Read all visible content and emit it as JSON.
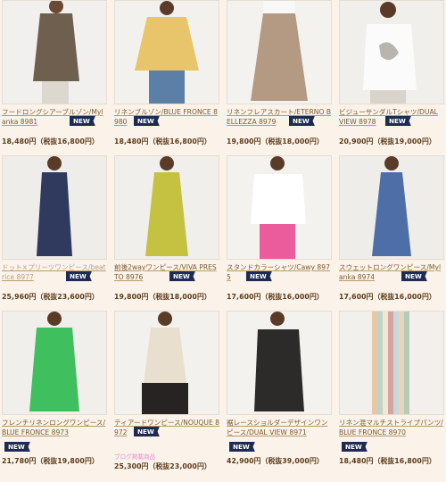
{
  "badge_label": "NEW",
  "products": [
    {
      "name": "フードロングシアーブルゾン/Mylanka 8981",
      "price": "18,480円（税抜16,800円）",
      "badge": "NEW"
    },
    {
      "name": "リネンブルゾン/BLUE FRONCE 8980",
      "price": "18,480円（税抜16,800円）",
      "badge": "NEW"
    },
    {
      "name": "リネンフレアスカート/ETERNO BELLEZZA 8979",
      "price": "19,800円（税抜18,000円）",
      "badge": "NEW"
    },
    {
      "name": "ビジューサンダルTシャツ/DUAL VIEW 8978",
      "price": "20,900円（税抜19,000円）",
      "badge": "NEW"
    },
    {
      "name": "ドット×プリーツワンピース/beatrice 8977",
      "price": "25,960円（税抜23,600円）",
      "badge": "NEW"
    },
    {
      "name": "前後2wayワンピース/VIVA PRESTO 8976",
      "price": "19,800円（税抜18,000円）",
      "badge": "NEW"
    },
    {
      "name": "スタンドカラーシャツ/Cawy 8975",
      "price": "17,600円（税抜16,000円）",
      "badge": "NEW"
    },
    {
      "name": "スウェットロングワンピース/Mylanka 8974",
      "price": "17,600円（税抜16,000円）",
      "badge": "NEW"
    },
    {
      "name": "フレンチリネンロングワンピース/BLUE FRONCE 8973",
      "price": "21,780円（税抜19,800円）",
      "badge": "NEW"
    },
    {
      "name": "ティアードワンピース/NOUQUE 8972",
      "price": "25,300円（税抜23,000円）",
      "badge": "NEW",
      "note": "ブログ掲載商品"
    },
    {
      "name": "裾レースショルダーデザインワンピース/DUAL VIEW 8971",
      "price": "42,900円（税抜39,000円）",
      "badge": "NEW"
    },
    {
      "name": "リネン混マルチストライプパンツ/BLUE FRONCE 8970",
      "price": "18,480円（税抜16,800円）",
      "badge": "NEW"
    }
  ]
}
